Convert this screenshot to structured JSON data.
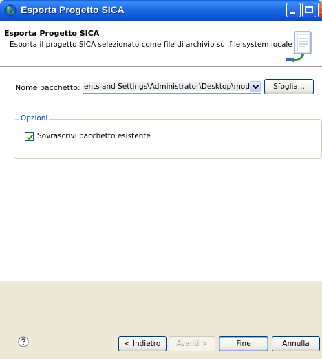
{
  "window": {
    "title": "Esporta Progetto SICA"
  },
  "header": {
    "title": "Esporta Progetto SICA",
    "description": "Esporta il progetto SICA selezionato come file di archivio sul file system locale"
  },
  "form": {
    "package_label": "Nome pacchetto:",
    "package_value": "Documents and Settings\\Administrator\\Desktop\\mod",
    "browse_label": "Sfoglia..."
  },
  "options": {
    "legend": "Opzioni",
    "overwrite_label": "Sovrascrivi pacchetto esistente",
    "overwrite_checked": true
  },
  "footer": {
    "back_label": "< Indietro",
    "next_label": "Avanti >",
    "finish_label": "Fine",
    "cancel_label": "Annulla"
  },
  "colors": {
    "titlebar": "#0a5fd8",
    "dialog_bg": "#ece9d8",
    "legend": "#0046d5"
  },
  "icons": {
    "app": "globe-app-icon",
    "minimize": "minimize-icon",
    "maximize": "maximize-icon",
    "close": "close-icon",
    "banner": "export-document-icon",
    "help": "help-icon"
  }
}
